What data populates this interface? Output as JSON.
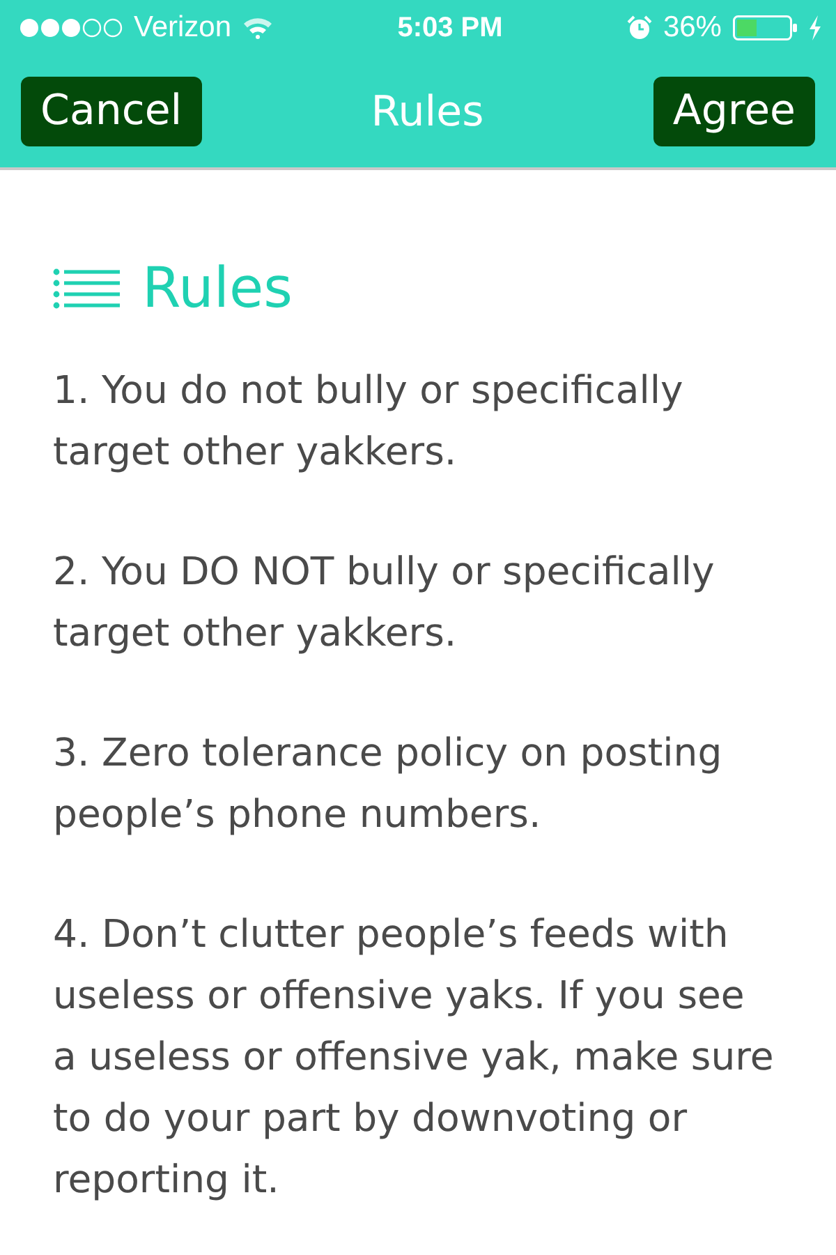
{
  "status_bar": {
    "carrier": "Verizon",
    "time": "5:03 PM",
    "battery_percent": "36%"
  },
  "nav_bar": {
    "left_button": "Cancel",
    "title": "Rules",
    "right_button": "Agree"
  },
  "content": {
    "heading": "Rules",
    "rules": [
      "1. You do not bully or specifically target other yakkers.",
      "2. You DO NOT bully or specifically target other yakkers.",
      "3. Zero tolerance policy on posting people’s phone numbers.",
      "4. Don’t clutter people’s feeds with useless or offensive yaks. If you see a useless or offensive yak, make sure to do your part by downvoting or reporting it."
    ]
  }
}
